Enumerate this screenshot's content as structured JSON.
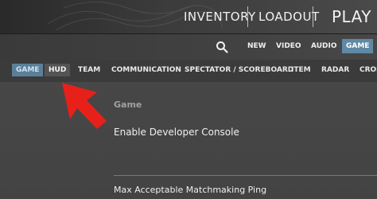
{
  "top_nav": {
    "inventory": "INVENTORY",
    "loadout": "LOADOUT",
    "play": "PLAY"
  },
  "settings_nav": {
    "search_icon": "search-icon",
    "items": [
      "NEW",
      "VIDEO",
      "AUDIO",
      "GAME"
    ],
    "active": "GAME"
  },
  "game_tabs": {
    "items": [
      "GAME",
      "HUD",
      "TEAM",
      "COMMUNICATION",
      "SPECTATOR / SCOREBOARD",
      "ITEM",
      "RADAR",
      "CROS"
    ],
    "active": "GAME",
    "highlighted": "HUD"
  },
  "content": {
    "section_title": "Game",
    "settings": [
      "Enable Developer Console",
      "Max Acceptable Matchmaking Ping"
    ]
  },
  "annotation": {
    "arrow_icon": "red-arrow-icon",
    "color": "#e8201a"
  },
  "colors": {
    "active_tab": "#5c7f98",
    "active_subtab": "#5f89a5",
    "background": "#3e3e3e"
  }
}
